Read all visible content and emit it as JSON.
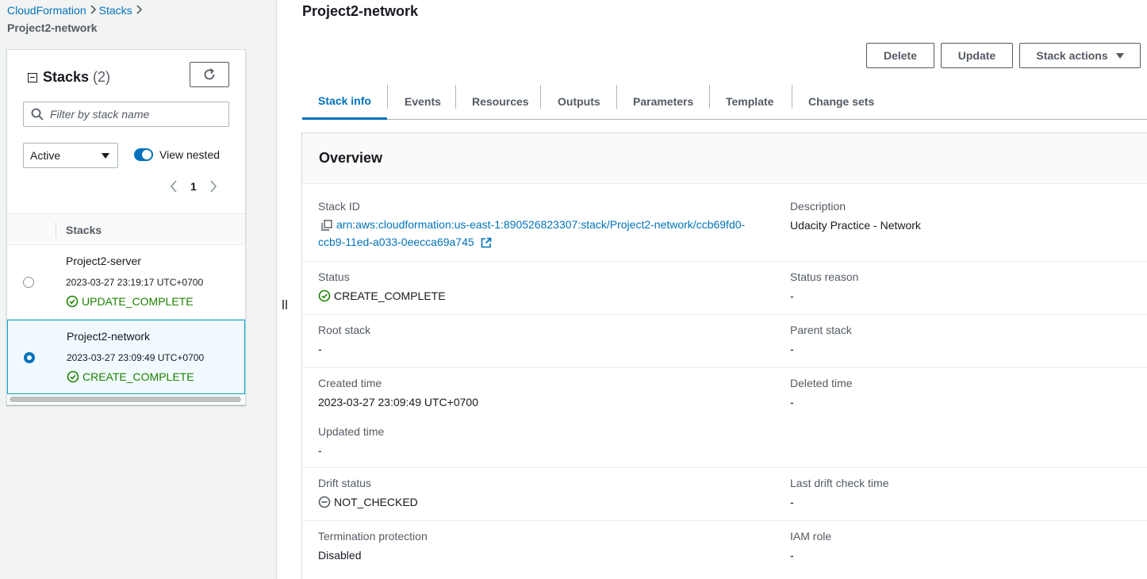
{
  "breadcrumb": {
    "items": [
      "CloudFormation",
      "Stacks"
    ],
    "current": "Project2-network"
  },
  "stacks_panel": {
    "title": "Stacks",
    "count": "(2)",
    "filter_placeholder": "Filter by stack name",
    "status_filter": "Active",
    "view_nested_label": "View nested",
    "page": "1",
    "column_header": "Stacks",
    "rows": [
      {
        "name": "Project2-server",
        "time": "2023-03-27 23:19:17 UTC+0700",
        "status": "UPDATE_COMPLETE",
        "selected": false
      },
      {
        "name": "Project2-network",
        "time": "2023-03-27 23:09:49 UTC+0700",
        "status": "CREATE_COMPLETE",
        "selected": true
      }
    ]
  },
  "header": {
    "title": "Project2-network",
    "delete_label": "Delete",
    "update_label": "Update",
    "stack_actions_label": "Stack actions"
  },
  "tabs": [
    "Stack info",
    "Events",
    "Resources",
    "Outputs",
    "Parameters",
    "Template",
    "Change sets"
  ],
  "overview": {
    "title": "Overview",
    "stack_id_label": "Stack ID",
    "stack_id_line1": "arn:aws:cloudformation:us-east-1:890526823307:stack/Project2-network/ccb69fd0-",
    "stack_id_line2": "ccb9-11ed-a033-0eecca69a745",
    "description_label": "Description",
    "description": "Udacity Practice - Network",
    "status_label": "Status",
    "status": "CREATE_COMPLETE",
    "status_reason_label": "Status reason",
    "status_reason": "-",
    "root_stack_label": "Root stack",
    "root_stack": "-",
    "parent_stack_label": "Parent stack",
    "parent_stack": "-",
    "created_time_label": "Created time",
    "created_time": "2023-03-27 23:09:49 UTC+0700",
    "deleted_time_label": "Deleted time",
    "deleted_time": "-",
    "updated_time_label": "Updated time",
    "updated_time": "-",
    "drift_status_label": "Drift status",
    "drift_status": "NOT_CHECKED",
    "last_drift_label": "Last drift check time",
    "last_drift": "-",
    "termination_label": "Termination protection",
    "termination": "Disabled",
    "iam_role_label": "IAM role",
    "iam_role": "-"
  },
  "colors": {
    "link": "#0073bb",
    "success": "#1d8102",
    "text": "#16191f",
    "muted": "#545b64"
  }
}
